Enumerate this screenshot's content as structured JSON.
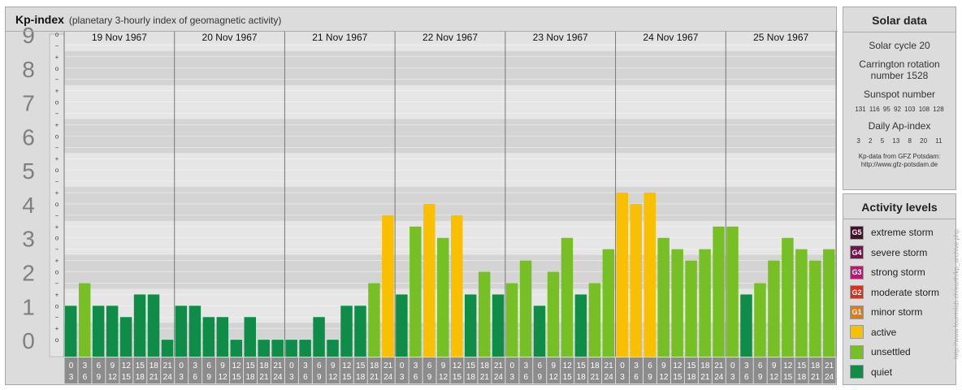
{
  "header": {
    "title": "Kp-index",
    "subtitle": "(planetary 3-hourly index of geomagnetic activity)"
  },
  "chart_data": {
    "type": "bar",
    "title": "Kp-index",
    "subtitle": "(planetary 3-hourly index of geomagnetic activity)",
    "ylim": [
      0,
      9
    ],
    "y_ticks": [
      "0",
      "1",
      "2",
      "3",
      "4",
      "5",
      "6",
      "7",
      "8",
      "9"
    ],
    "y_subticks": [
      "o",
      "+",
      "−"
    ],
    "days": [
      "19 Nov 1967",
      "20 Nov 1967",
      "21 Nov 1967",
      "22 Nov 1967",
      "23 Nov 1967",
      "24 Nov 1967",
      "25 Nov 1967"
    ],
    "interval_start_labels": [
      "0",
      "3",
      "6",
      "9",
      "12",
      "15",
      "18",
      "21"
    ],
    "interval_end_labels": [
      "3",
      "6",
      "9",
      "12",
      "15",
      "18",
      "21",
      "24"
    ],
    "values": [
      1,
      1.667,
      1,
      1,
      0.667,
      1.333,
      1.333,
      0,
      1,
      1,
      0.667,
      0.667,
      0,
      0.667,
      0,
      0,
      0,
      0,
      0.667,
      0,
      1,
      1,
      1.667,
      3.667,
      1.333,
      3.333,
      4,
      3,
      3.667,
      1.333,
      2,
      1.333,
      1.667,
      2.333,
      1,
      2,
      3,
      1.333,
      1.667,
      2.667,
      4.333,
      4,
      4.333,
      3,
      2.667,
      2.333,
      2.667,
      3.333,
      3.333,
      1.333,
      1.667,
      2.333,
      3,
      2.667,
      2.333,
      2.667
    ],
    "levels": [
      "quiet",
      "unsettled",
      "active"
    ],
    "grid": true
  },
  "solar": {
    "title": "Solar data",
    "cycle": "Solar cycle 20",
    "carrington": "Carrington rotation number 1528",
    "sunspot_label": "Sunspot number",
    "sunspot_values": "131 116 95 92 103 108 128",
    "ap_label": "Daily Ap-index",
    "ap_values": "3 2 5 13 8 20 11",
    "credit_line1": "Kp-data from GFZ Potsdam:",
    "credit_line2": "http://www.gfz-potsdam.de"
  },
  "activity": {
    "title": "Activity levels",
    "items": [
      {
        "code": "G5",
        "label": "extreme storm",
        "color": "#4a0d2a"
      },
      {
        "code": "G4",
        "label": "severe storm",
        "color": "#76124e"
      },
      {
        "code": "G3",
        "label": "strong storm",
        "color": "#b51a6e"
      },
      {
        "code": "G2",
        "label": "moderate storm",
        "color": "#d6331f"
      },
      {
        "code": "G1",
        "label": "minor storm",
        "color": "#e07a14"
      },
      {
        "code": "",
        "label": "active",
        "color": "#f8c000"
      },
      {
        "code": "",
        "label": "unsettled",
        "color": "#76c026"
      },
      {
        "code": "",
        "label": "quiet",
        "color": "#0e8c48"
      }
    ]
  },
  "colors": {
    "quiet": "#0e8c48",
    "unsettled": "#76c026",
    "active": "#f8c000"
  },
  "side_credit": "http://www.fourmilab.ch/earth/kp_archive.php"
}
